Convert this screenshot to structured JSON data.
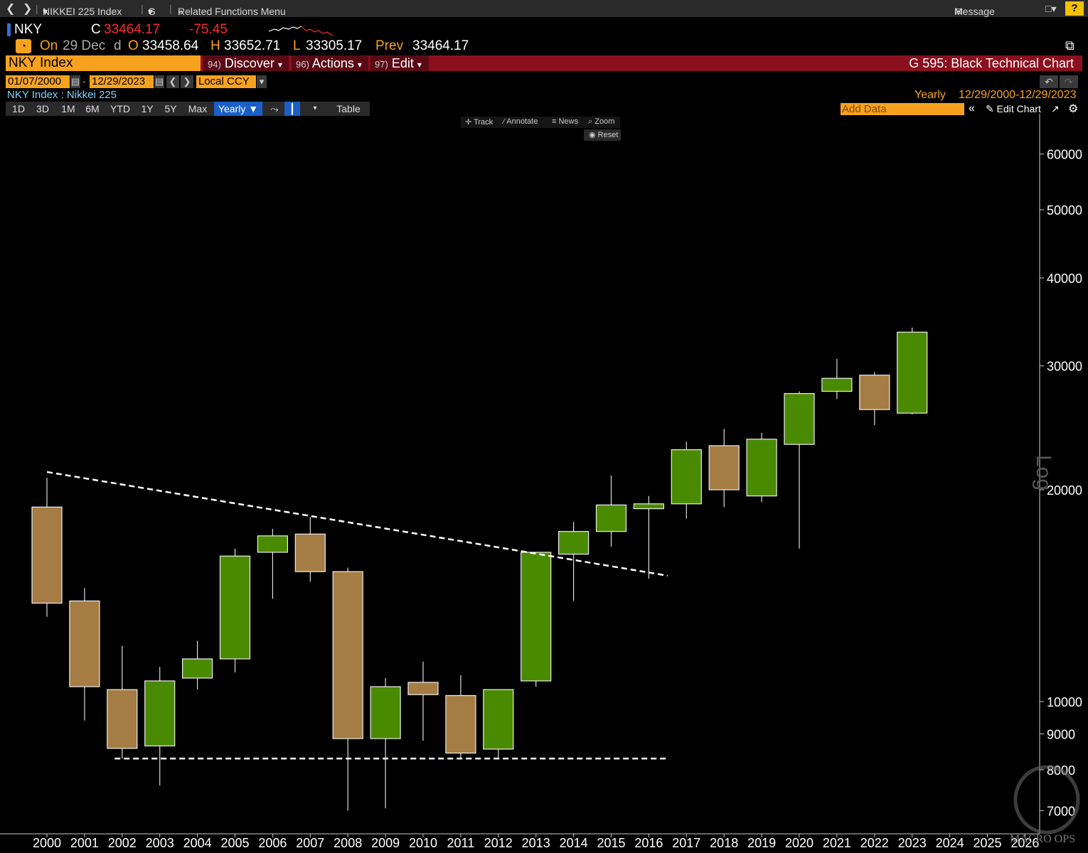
{
  "nav": {
    "security": "NIKKEI 225 Index",
    "g_menu": "G",
    "related": "Related Functions Menu",
    "message": "Message",
    "help": "?"
  },
  "quote": {
    "ticker": "NKY",
    "c_label": "C",
    "last": "33464.17",
    "change": "-75.45",
    "on_label": "On",
    "date": "29 Dec",
    "d_label": "d",
    "o_label": "O",
    "open": "33458.64",
    "h_label": "H",
    "high": "33652.71",
    "l_label": "L",
    "low": "33305.17",
    "prev_label": "Prev",
    "prev": "33464.17"
  },
  "titlebar": {
    "security": "NKY Index",
    "discover": "Discover",
    "discover_num": "94)",
    "actions": "Actions",
    "actions_num": "96)",
    "edit": "Edit",
    "edit_num": "97)",
    "chart_name": "G 595: Black Technical Chart"
  },
  "daterow": {
    "start": "01/07/2000",
    "end": "12/29/2023",
    "currency": "Local CCY",
    "legend": "NKY Index : Nikkei 225",
    "period": "Yearly",
    "range": "12/29/2000-12/29/2023"
  },
  "tabs": [
    "1D",
    "3D",
    "1M",
    "6M",
    "YTD",
    "1Y",
    "5Y",
    "Max"
  ],
  "active_tab": "Yearly",
  "table_label": "Table",
  "add_data": "Add Data",
  "edit_chart": "Edit Chart",
  "tools": {
    "track": "Track",
    "annotate": "Annotate",
    "news": "News",
    "zoom": "Zoom",
    "reset": "Reset"
  },
  "log_label": "Log",
  "watermark": "MACRO OPS",
  "colors": {
    "up": "#4a8a00",
    "down": "#a57c44",
    "accent": "#f7a21e",
    "title_bar": "#8b0f1e"
  },
  "chart_data": {
    "type": "candlestick",
    "scale": "log",
    "ylim": [
      6700,
      66000
    ],
    "y_ticks": [
      60000,
      50000,
      40000,
      30000,
      20000,
      10000,
      9000,
      8000,
      7000
    ],
    "x_ticks": [
      "2000",
      "2001",
      "2002",
      "2003",
      "2004",
      "2005",
      "2006",
      "2007",
      "2008",
      "2009",
      "2010",
      "2011",
      "2012",
      "2013",
      "2014",
      "2015",
      "2016",
      "2017",
      "2018",
      "2019",
      "2020",
      "2021",
      "2022",
      "2023",
      "2024",
      "2025",
      "2026"
    ],
    "candles": [
      {
        "x": "2000",
        "open": 18900,
        "high": 20800,
        "low": 13200,
        "close": 13800
      },
      {
        "x": "2001",
        "open": 13900,
        "high": 14500,
        "low": 9400,
        "close": 10500
      },
      {
        "x": "2002",
        "open": 10400,
        "high": 12000,
        "low": 8300,
        "close": 8580
      },
      {
        "x": "2003",
        "open": 8650,
        "high": 11200,
        "low": 7600,
        "close": 10700
      },
      {
        "x": "2004",
        "open": 10800,
        "high": 12200,
        "low": 10400,
        "close": 11500
      },
      {
        "x": "2005",
        "open": 11500,
        "high": 16500,
        "low": 11000,
        "close": 16100
      },
      {
        "x": "2006",
        "open": 16300,
        "high": 17600,
        "low": 14000,
        "close": 17200
      },
      {
        "x": "2007",
        "open": 17300,
        "high": 18300,
        "low": 14800,
        "close": 15300
      },
      {
        "x": "2008",
        "open": 15300,
        "high": 15500,
        "low": 7000,
        "close": 8860
      },
      {
        "x": "2009",
        "open": 8860,
        "high": 10800,
        "low": 7050,
        "close": 10500
      },
      {
        "x": "2010",
        "open": 10650,
        "high": 11400,
        "low": 8800,
        "close": 10230
      },
      {
        "x": "2011",
        "open": 10200,
        "high": 10900,
        "low": 8300,
        "close": 8450
      },
      {
        "x": "2012",
        "open": 8560,
        "high": 10400,
        "low": 8300,
        "close": 10400
      },
      {
        "x": "2013",
        "open": 10700,
        "high": 16300,
        "low": 10500,
        "close": 16300
      },
      {
        "x": "2014",
        "open": 16200,
        "high": 18000,
        "low": 13900,
        "close": 17450
      },
      {
        "x": "2015",
        "open": 17450,
        "high": 20950,
        "low": 16600,
        "close": 19030
      },
      {
        "x": "2016",
        "open": 18800,
        "high": 19600,
        "low": 14950,
        "close": 19100
      },
      {
        "x": "2017",
        "open": 19100,
        "high": 23400,
        "low": 18200,
        "close": 22800
      },
      {
        "x": "2018",
        "open": 23100,
        "high": 24400,
        "low": 18900,
        "close": 20000
      },
      {
        "x": "2019",
        "open": 19600,
        "high": 24100,
        "low": 19200,
        "close": 23600
      },
      {
        "x": "2020",
        "open": 23200,
        "high": 27600,
        "low": 16500,
        "close": 27400
      },
      {
        "x": "2021",
        "open": 27600,
        "high": 30700,
        "low": 26900,
        "close": 28800
      },
      {
        "x": "2022",
        "open": 29100,
        "high": 29400,
        "low": 24700,
        "close": 26000
      },
      {
        "x": "2023",
        "open": 25700,
        "high": 34000,
        "low": 25600,
        "close": 33500
      }
    ],
    "trendlines": [
      {
        "from": [
          "2000",
          21200
        ],
        "to": [
          "2016.5",
          15100
        ],
        "style": "dashed"
      },
      {
        "from": [
          "2001.8",
          8300
        ],
        "to": [
          "2016.5",
          8300
        ],
        "style": "dashed"
      }
    ]
  }
}
